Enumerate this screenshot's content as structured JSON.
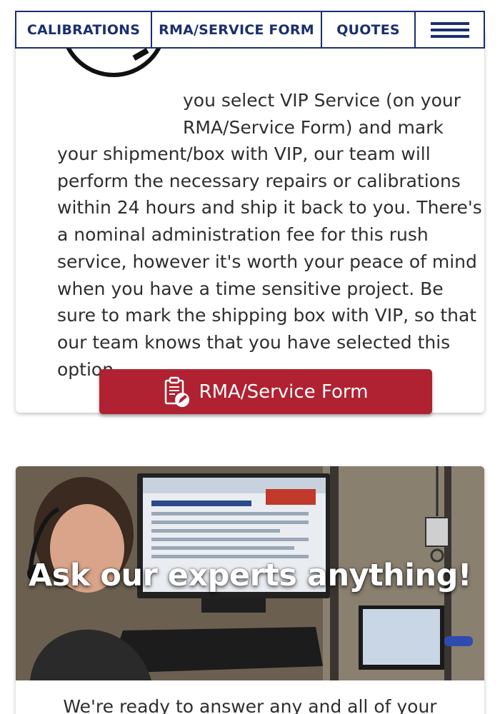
{
  "nav": {
    "calibrations": "CALIBRATIONS",
    "rma_form": "RMA/SERVICE FORM",
    "quotes": "QUOTES",
    "menu_icon": "hamburger-menu-icon"
  },
  "vip_section": {
    "intro_lines": "you select VIP Service (on your RMA/Service Form) and mark",
    "body": "your shipment/box with VIP, our team will perform the necessary repairs or calibrations within 24 hours and ship it back to you. There's a nominal administration fee for this rush service, however it's worth your peace of mind when you have a time sensitive project. Be sure to mark the shipping box with VIP, so that our team knows that you have selected this option.",
    "button_label": "RMA/Service Form",
    "button_icon": "form-edit-icon"
  },
  "experts_section": {
    "headline": "Ask our experts anything!",
    "teaser": "We're ready to answer any and all of your"
  },
  "colors": {
    "nav_blue": "#1b2f6e",
    "button_red": "#b02231"
  }
}
